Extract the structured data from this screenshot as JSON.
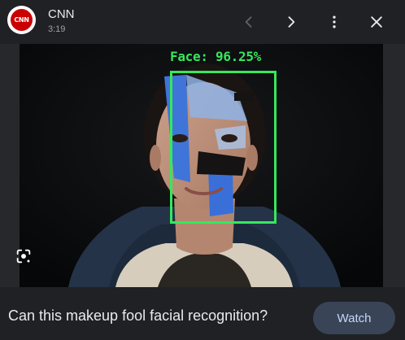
{
  "header": {
    "logo_text": "CNN",
    "source_name": "CNN",
    "duration": "3:19",
    "icons": {
      "prev": "chevron-left-icon",
      "next": "chevron-right-icon",
      "more": "more-vert-icon",
      "close": "close-icon"
    }
  },
  "media": {
    "detection_label": "Face: 96.25%",
    "lens_icon": "lens-icon"
  },
  "footer": {
    "caption": "Can this makeup fool facial recognition?",
    "watch_label": "Watch"
  },
  "colors": {
    "background": "#202124",
    "detection": "#35e85c",
    "logo_red": "#cc0000",
    "watch_bg": "#394457",
    "watch_text": "#c7d7f8"
  }
}
